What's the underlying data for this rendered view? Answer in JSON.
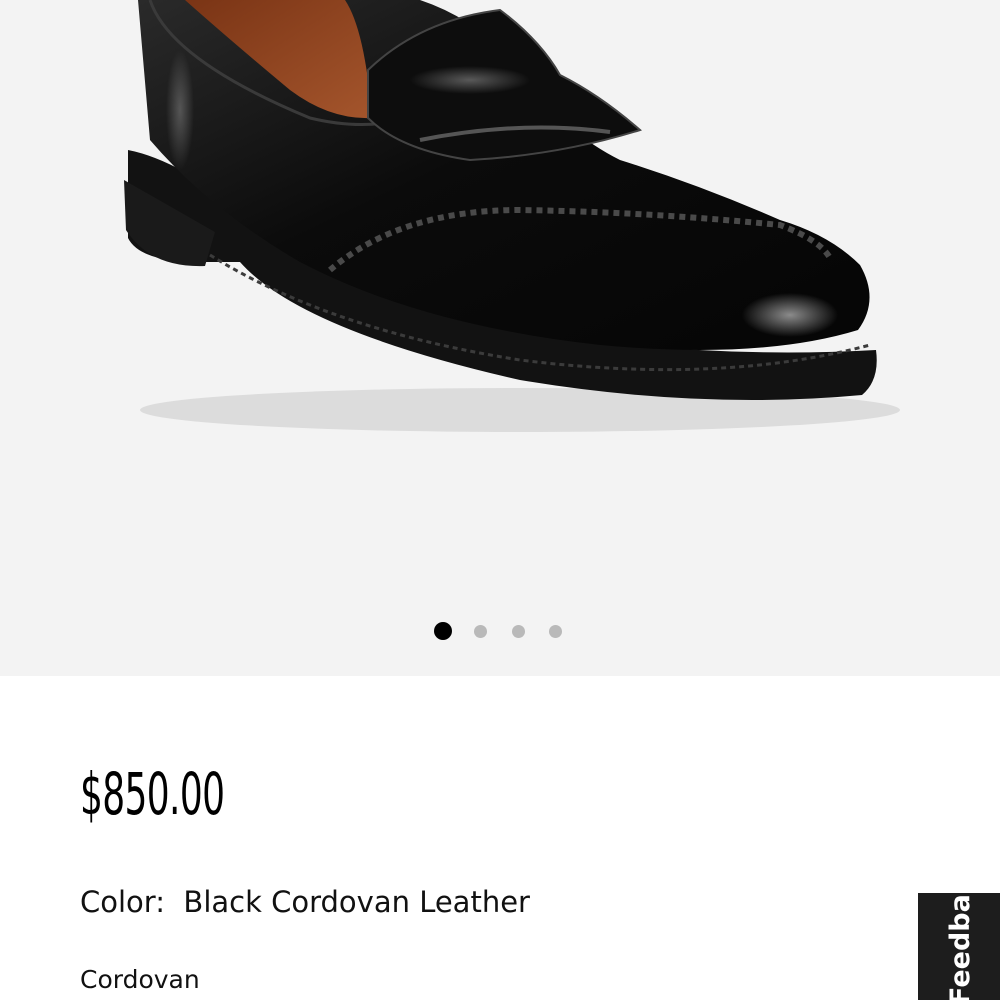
{
  "gallery": {
    "image_name": "black-cordovan-penny-loafer",
    "slide_count": 4,
    "active_slide": 1
  },
  "product": {
    "price": "$850.00",
    "color_label": "Color:",
    "color_value": "Black Cordovan Leather",
    "material": "Cordovan"
  },
  "feedback": {
    "label": "Feedback"
  },
  "colors": {
    "gallery_bg": "#f3f3f3",
    "dot_active": "#000000",
    "dot_inactive": "#b9b9b9",
    "feedback_bg": "#1d1d1d"
  }
}
